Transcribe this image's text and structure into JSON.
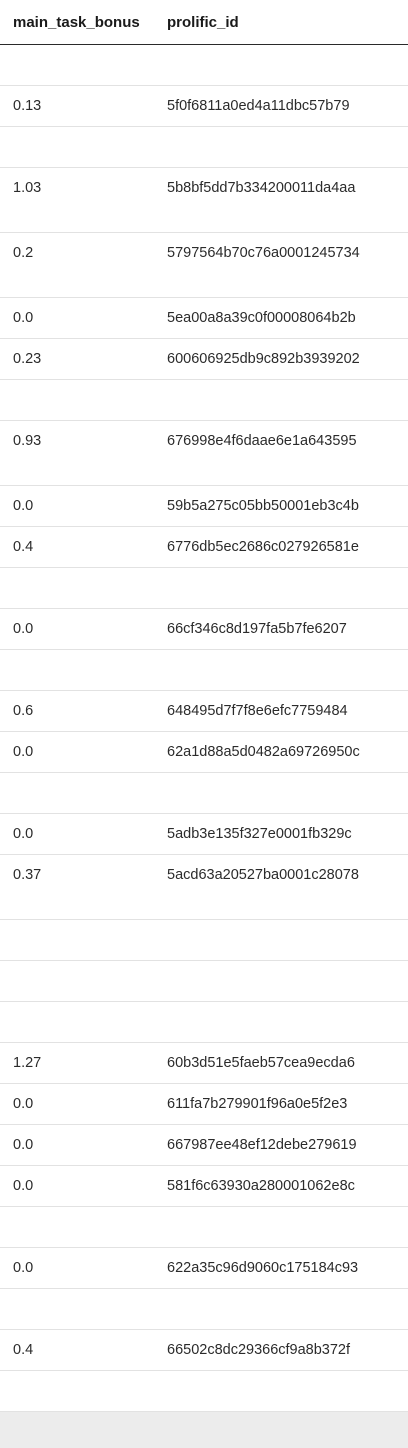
{
  "table": {
    "columns": [
      "main_task_bonus",
      "prolific_id"
    ],
    "rows": [
      {
        "bonus": "",
        "id": "",
        "h": "short"
      },
      {
        "bonus": "0.13",
        "id": "5f0f6811a0ed4a11dbc57b79",
        "h": "short"
      },
      {
        "bonus": "",
        "id": "",
        "h": "short"
      },
      {
        "bonus": "1.03",
        "id": "5b8bf5dd7b334200011da4aa",
        "h": "tall"
      },
      {
        "bonus": "0.2",
        "id": "5797564b70c76a0001245734",
        "h": "tall"
      },
      {
        "bonus": "0.0",
        "id": "5ea00a8a39c0f00008064b2b",
        "h": "short"
      },
      {
        "bonus": "0.23",
        "id": "600606925db9c892b3939202",
        "h": "short"
      },
      {
        "bonus": "",
        "id": "",
        "h": "short"
      },
      {
        "bonus": "0.93",
        "id": "676998e4f6daae6e1a643595",
        "h": "tall"
      },
      {
        "bonus": "0.0",
        "id": "59b5a275c05bb50001eb3c4b",
        "h": "short"
      },
      {
        "bonus": "0.4",
        "id": "6776db5ec2686c027926581e",
        "h": "short"
      },
      {
        "bonus": "",
        "id": "",
        "h": "short"
      },
      {
        "bonus": "0.0",
        "id": "66cf346c8d197fa5b7fe6207",
        "h": "short"
      },
      {
        "bonus": "",
        "id": "",
        "h": "short"
      },
      {
        "bonus": "0.6",
        "id": "648495d7f7f8e6efc7759484",
        "h": "short"
      },
      {
        "bonus": "0.0",
        "id": "62a1d88a5d0482a69726950c",
        "h": "short"
      },
      {
        "bonus": "",
        "id": "",
        "h": "short"
      },
      {
        "bonus": "0.0",
        "id": "5adb3e135f327e0001fb329c",
        "h": "short"
      },
      {
        "bonus": "0.37",
        "id": "5acd63a20527ba0001c28078",
        "h": "tall"
      },
      {
        "bonus": "",
        "id": "",
        "h": "short"
      },
      {
        "bonus": "",
        "id": "",
        "h": "short"
      },
      {
        "bonus": "",
        "id": "",
        "h": "short"
      },
      {
        "bonus": "1.27",
        "id": "60b3d51e5faeb57cea9ecda6",
        "h": "short"
      },
      {
        "bonus": "0.0",
        "id": "611fa7b279901f96a0e5f2e3",
        "h": "short"
      },
      {
        "bonus": "0.0",
        "id": "667987ee48ef12debe279619",
        "h": "short"
      },
      {
        "bonus": "0.0",
        "id": "581f6c63930a280001062e8c",
        "h": "short"
      },
      {
        "bonus": "",
        "id": "",
        "h": "short"
      },
      {
        "bonus": "0.0",
        "id": "622a35c96d9060c175184c93",
        "h": "short"
      },
      {
        "bonus": "",
        "id": "",
        "h": "short"
      },
      {
        "bonus": "0.4",
        "id": "66502c8dc29366cf9a8b372f",
        "h": "short"
      },
      {
        "bonus": "",
        "id": "",
        "h": "short"
      }
    ]
  }
}
